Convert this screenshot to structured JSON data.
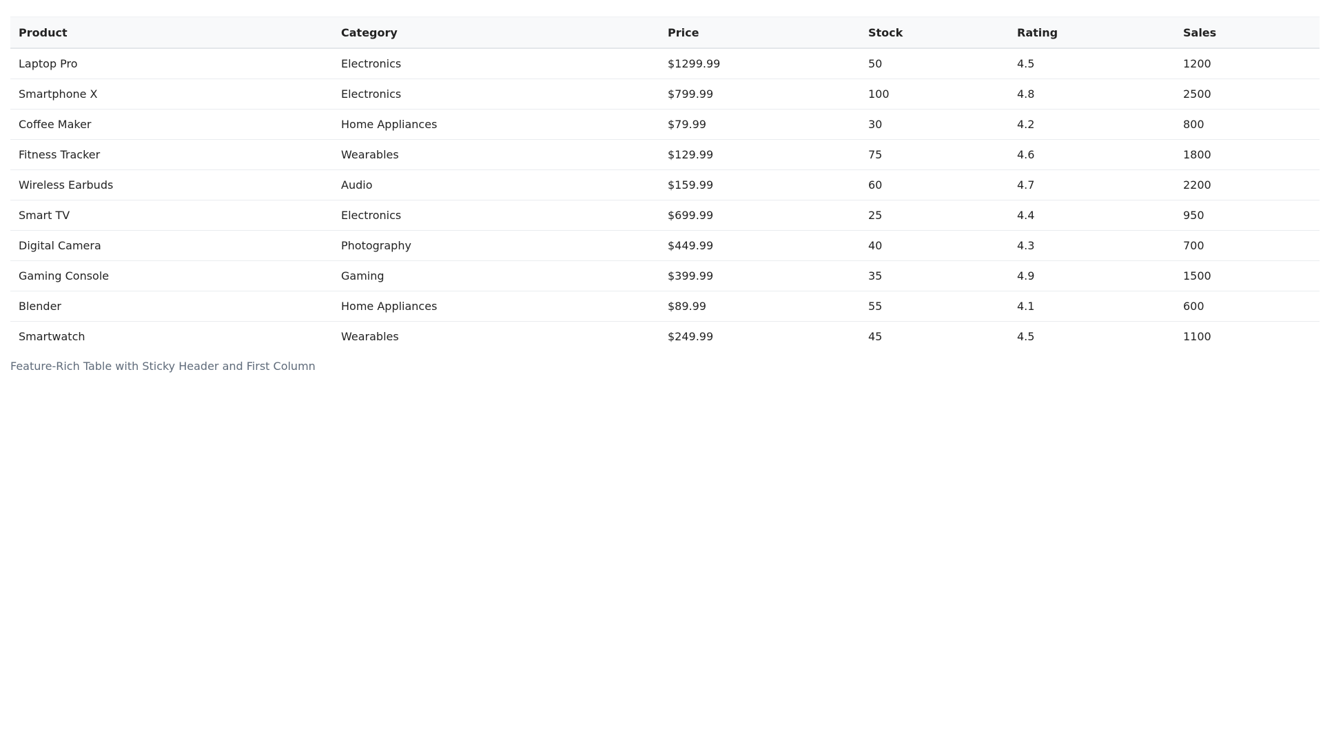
{
  "table": {
    "headers": [
      "Product",
      "Category",
      "Price",
      "Stock",
      "Rating",
      "Sales"
    ],
    "rows": [
      [
        "Laptop Pro",
        "Electronics",
        "$1299.99",
        "50",
        "4.5",
        "1200"
      ],
      [
        "Smartphone X",
        "Electronics",
        "$799.99",
        "100",
        "4.8",
        "2500"
      ],
      [
        "Coffee Maker",
        "Home Appliances",
        "$79.99",
        "30",
        "4.2",
        "800"
      ],
      [
        "Fitness Tracker",
        "Wearables",
        "$129.99",
        "75",
        "4.6",
        "1800"
      ],
      [
        "Wireless Earbuds",
        "Audio",
        "$159.99",
        "60",
        "4.7",
        "2200"
      ],
      [
        "Smart TV",
        "Electronics",
        "$699.99",
        "25",
        "4.4",
        "950"
      ],
      [
        "Digital Camera",
        "Photography",
        "$449.99",
        "40",
        "4.3",
        "700"
      ],
      [
        "Gaming Console",
        "Gaming",
        "$399.99",
        "35",
        "4.9",
        "1500"
      ],
      [
        "Blender",
        "Home Appliances",
        "$89.99",
        "55",
        "4.1",
        "600"
      ],
      [
        "Smartwatch",
        "Wearables",
        "$249.99",
        "45",
        "4.5",
        "1100"
      ]
    ]
  },
  "caption": "Feature-Rich Table with Sticky Header and First Column"
}
